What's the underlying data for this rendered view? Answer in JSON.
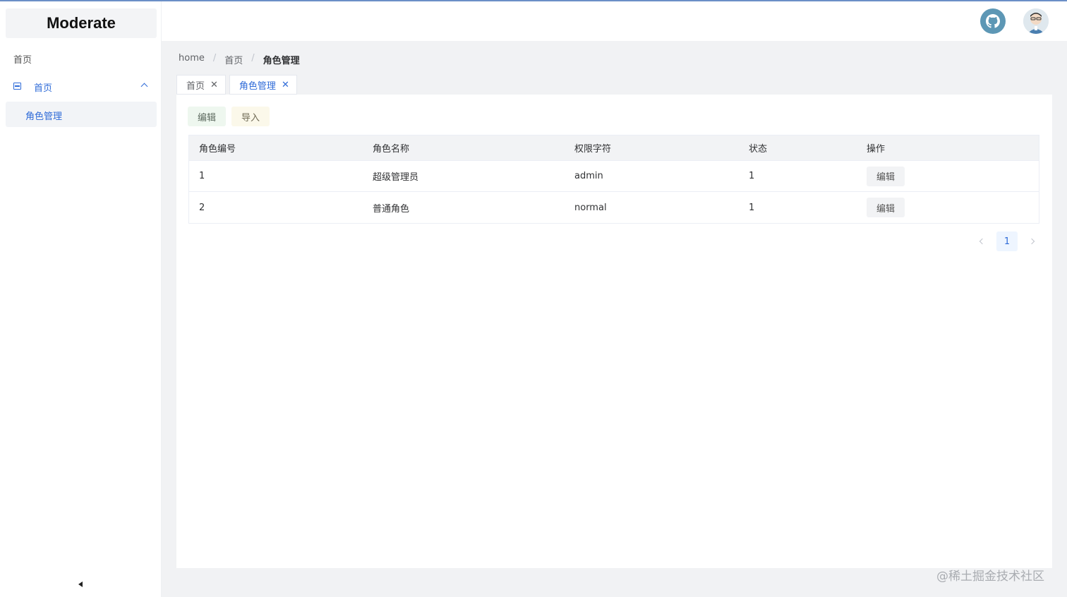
{
  "app": {
    "logo": "Moderate"
  },
  "sidebar": {
    "home_label": "首页",
    "group": {
      "label": "首页",
      "icon": "menu-grid-icon",
      "expanded": true
    },
    "items": [
      {
        "label": "角色管理",
        "active": true
      }
    ],
    "collapse_icon": "caret-left-icon"
  },
  "header": {
    "github_icon": "github-icon",
    "avatar": "user-avatar"
  },
  "breadcrumb": {
    "items": [
      "home",
      "首页",
      "角色管理"
    ]
  },
  "tabs": [
    {
      "label": "首页",
      "active": false
    },
    {
      "label": "角色管理",
      "active": true
    }
  ],
  "toolbar": {
    "edit_label": "编辑",
    "import_label": "导入"
  },
  "table": {
    "headers": [
      "角色编号",
      "角色名称",
      "权限字符",
      "状态",
      "操作"
    ],
    "rows": [
      {
        "id": "1",
        "name": "超级管理员",
        "key": "admin",
        "status": "1",
        "action": "编辑"
      },
      {
        "id": "2",
        "name": "普通角色",
        "key": "normal",
        "status": "1",
        "action": "编辑"
      }
    ]
  },
  "pagination": {
    "current": "1"
  },
  "watermark": "@稀土掘金技术社区",
  "colors": {
    "accent": "#2f6bd8",
    "github_bg": "#5d97b5",
    "main_bg": "#f1f2f4"
  }
}
